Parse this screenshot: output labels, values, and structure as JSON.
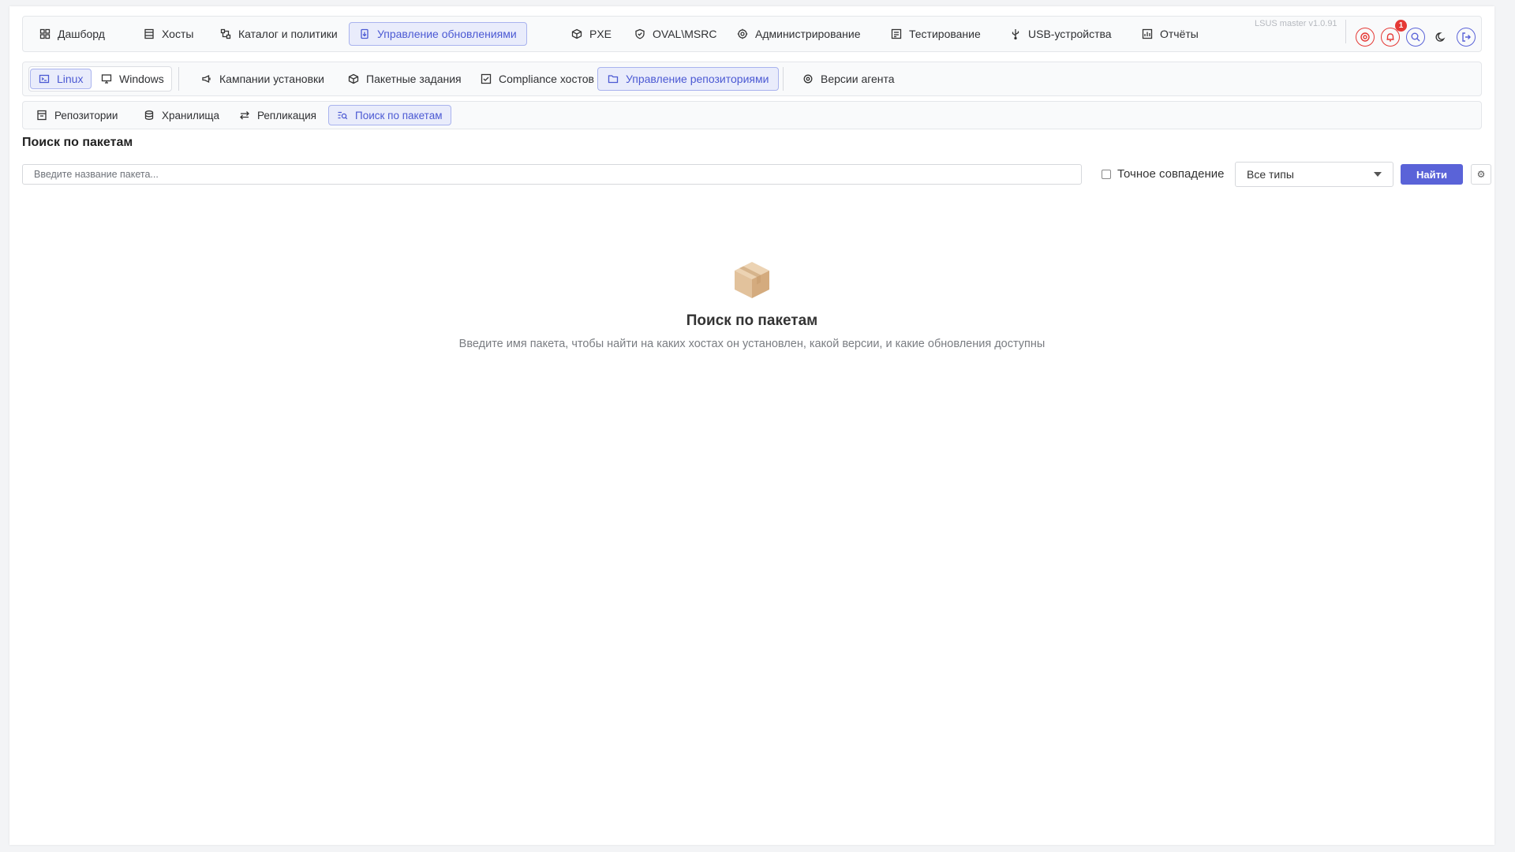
{
  "top_nav": {
    "items": [
      {
        "label": "Дашборд",
        "icon": "dashboard-icon"
      },
      {
        "label": "Хосты",
        "icon": "server-icon"
      },
      {
        "label": "Каталог и политики",
        "icon": "hierarchy-icon"
      },
      {
        "label": "Управление обновлениями",
        "icon": "update-icon",
        "active": true
      },
      {
        "label": "PXE",
        "icon": "cube-icon"
      },
      {
        "label": "OVAL\\MSRC",
        "icon": "shield-icon"
      },
      {
        "label": "Администрирование",
        "icon": "admin-icon"
      },
      {
        "label": "Тестирование",
        "icon": "test-icon"
      },
      {
        "label": "USB-устройства",
        "icon": "usb-icon"
      },
      {
        "label": "Отчёты",
        "icon": "report-icon"
      }
    ],
    "version": "LSUS master v1.0.91",
    "notification_count": "1"
  },
  "sub_nav": {
    "os_toggle": [
      {
        "label": "Linux",
        "icon": "terminal-icon",
        "active": true
      },
      {
        "label": "Windows",
        "icon": "monitor-icon"
      }
    ],
    "items": [
      {
        "label": "Кампании установки",
        "icon": "megaphone-icon"
      },
      {
        "label": "Пакетные задания",
        "icon": "cube-icon"
      },
      {
        "label": "Compliance хостов",
        "icon": "compliance-icon"
      },
      {
        "label": "Управление репозиториями",
        "icon": "folder-icon",
        "active": true
      },
      {
        "label": "Версии агента",
        "icon": "agent-icon"
      }
    ]
  },
  "third_nav": {
    "items": [
      {
        "label": "Репозитории",
        "icon": "repository-icon"
      },
      {
        "label": "Хранилища",
        "icon": "database-icon"
      },
      {
        "label": "Репликация",
        "icon": "swap-icon"
      },
      {
        "label": "Поиск по пакетам",
        "icon": "search-list-icon",
        "active": true
      }
    ]
  },
  "page": {
    "title": "Поиск по пакетам",
    "search_placeholder": "Введите название пакета...",
    "search_value": "",
    "exact_match_label": "Точное совпадение",
    "exact_match_checked": false,
    "type_select_value": "Все типы",
    "find_button": "Найти",
    "settings_icon": "gear-icon"
  },
  "empty_state": {
    "icon": "package-box-icon",
    "title": "Поиск по пакетам",
    "description": "Введите имя пакета, чтобы найти на каких хостах он установлен, какой версии, и какие обновления доступны"
  },
  "colors": {
    "accent": "#5a63d8",
    "active_bg": "#e9ecfb",
    "active_text": "#4b59d3",
    "danger": "#e53935"
  }
}
